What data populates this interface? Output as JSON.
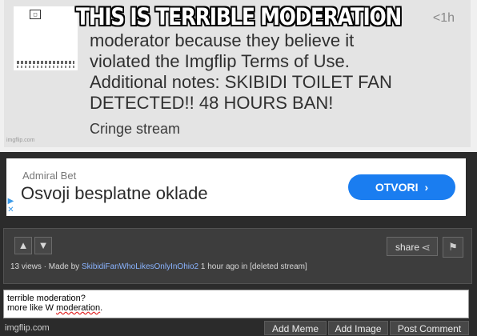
{
  "meme": {
    "caption": "THIS IS TERRIBLE MODERATION",
    "time": "<1h",
    "notice_lines": [
      "moderator because they believe it",
      "violated the Imgflip Terms of Use.",
      "Additional notes: SKIBIDI TOILET FAN",
      "DETECTED!! 48 HOURS BAN!"
    ],
    "stream": "Cringe stream",
    "watermark": "imgflip.com"
  },
  "ad": {
    "brand": "Admiral Bet",
    "headline": "Osvoji besplatne oklade",
    "button": "OTVORI",
    "button_color": "#1a7df0",
    "choice_icon": "ad-choices-icon"
  },
  "post": {
    "upvote_icon": "▲",
    "downvote_icon": "▼",
    "share_label": "share",
    "views": "13 views",
    "made_by": "Made by",
    "username": "SkibidiFanWhoLikesOnlyInOhio2",
    "posted": "1 hour ago in",
    "stream": "[deleted stream]"
  },
  "comment": {
    "line1": "terrible moderation?",
    "line2_a": "more like W ",
    "line2_b": "moderation",
    "line2_c": "."
  },
  "footer": {
    "brand": "imgflip.com",
    "add_meme": "Add Meme",
    "add_image": "Add Image",
    "post_comment": "Post Comment"
  }
}
